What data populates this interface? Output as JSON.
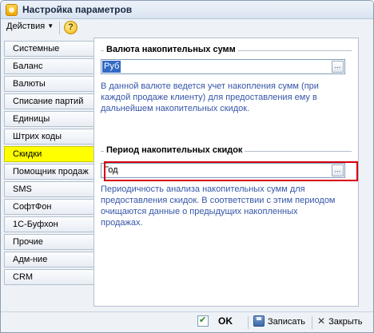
{
  "window": {
    "title": "Настройка параметров"
  },
  "toolbar": {
    "actions_label": "Действия",
    "help_label": "?"
  },
  "nav": {
    "items": [
      "Системные",
      "Баланс",
      "Валюты",
      "Списание партий",
      "Единицы",
      "Штрих коды",
      "Скидки",
      "Помощник продаж",
      "SMS",
      "СофтФон",
      "1С-Буфхон",
      "Прочие",
      "Адм-ние",
      "CRM"
    ],
    "active": "Скидки"
  },
  "currency_group": {
    "legend": "Валюта накопительных сумм",
    "value": "Руб",
    "hint": "В данной валюте ведется учет накопления сумм (при каждой продаже клиенту) для предоставления ему в дальнейшем накопительных скидок."
  },
  "period_group": {
    "legend": "Период накопительных скидок",
    "value": "Год",
    "hint": "Периодичность анализа накопительных сумм для предоставления скидок. В соответствии с этим периодом очищаются данные о предыдущих накопленных продажах."
  },
  "buttons": {
    "choose": "...",
    "ok": "OK",
    "save": "Записать",
    "close": "Закрыть"
  },
  "colors": {
    "active_tab": "#ffff00",
    "highlight_border": "#d6000e",
    "hint_text": "#3556a8"
  }
}
